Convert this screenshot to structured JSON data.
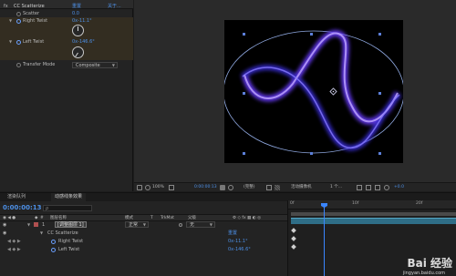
{
  "effect_panel": {
    "effect_name": "CC Scatterize",
    "reset_label": "重置",
    "about_label": "关于...",
    "props": [
      {
        "label": "Scatter",
        "value": "0.0"
      },
      {
        "label": "Right Twist",
        "value": "0x-11.1°"
      },
      {
        "label": "Left Twist",
        "value": "0x-146.6°"
      },
      {
        "label": "Transfer Mode",
        "value": "Composite"
      }
    ]
  },
  "viewer_toolbar": {
    "zoom": "100%",
    "timecode": "0:00:00:13",
    "resolution": "(完整)",
    "camera": "活动摄像机",
    "views": "1 个...",
    "exposure": "+0.0"
  },
  "timeline": {
    "tabs": [
      "渲染队列",
      "动感线条效果"
    ],
    "current_time": "0:00:00:13",
    "search_placeholder": "ρ",
    "columns": {
      "layer_name": "图层名称",
      "mode": "模式",
      "t": "T",
      "trkmat": "TrkMat",
      "parent": "父级"
    },
    "layer": {
      "index": "1",
      "name": "[调整图层 1]",
      "mode": "正常",
      "parent": "无"
    },
    "effect_row": {
      "name": "CC Scatterize",
      "reset": "重置"
    },
    "properties": [
      {
        "name": "Right Twist",
        "value": "0x-11.1°"
      },
      {
        "name": "Left Twist",
        "value": "0x-146.6°"
      }
    ],
    "ruler_labels": [
      "0f",
      "10f",
      "20f"
    ]
  },
  "watermark": {
    "brand": "Bai 经验",
    "url": "jingyan.baidu.com"
  }
}
